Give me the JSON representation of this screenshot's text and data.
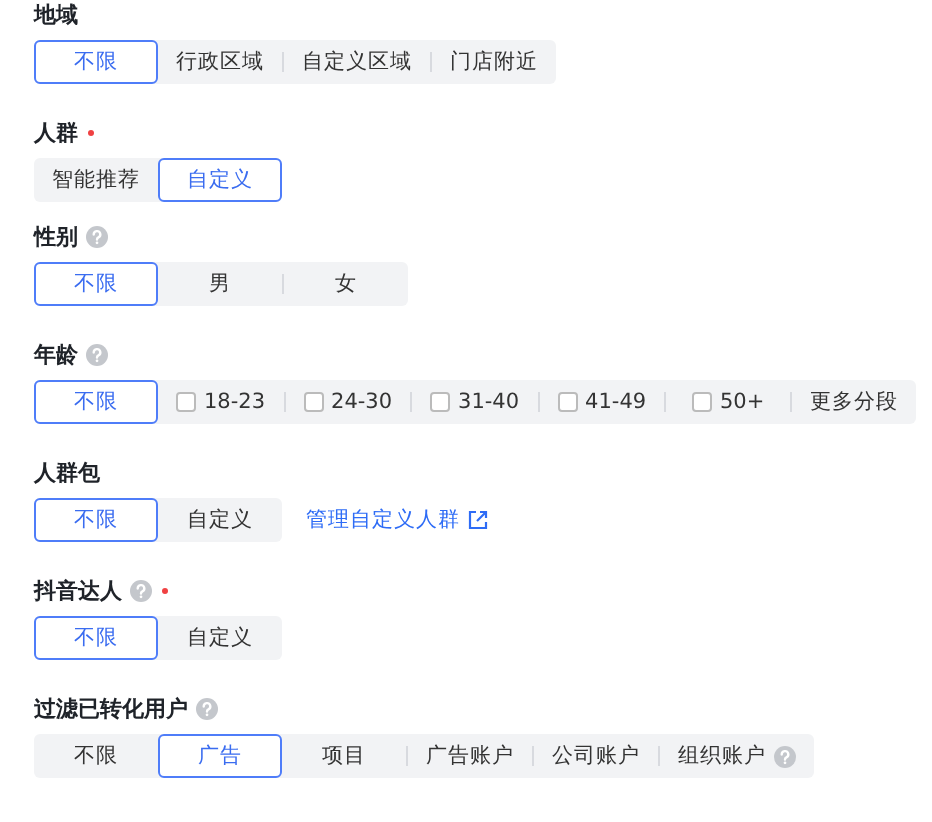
{
  "sections": [
    {
      "label": "地域",
      "required": false,
      "help": false,
      "options": [
        {
          "kind": "plain",
          "label": "不限",
          "selected": true
        },
        {
          "kind": "plain",
          "label": "行政区域",
          "selected": false
        },
        {
          "kind": "plain",
          "label": "自定义区域",
          "selected": false
        },
        {
          "kind": "plain",
          "label": "门店附近",
          "selected": false
        }
      ]
    },
    {
      "label": "人群",
      "required": true,
      "help": false,
      "options": [
        {
          "kind": "plain",
          "label": "智能推荐",
          "selected": false
        },
        {
          "kind": "plain",
          "label": "自定义",
          "selected": true
        }
      ]
    },
    {
      "label": "性别",
      "required": false,
      "help": true,
      "options": [
        {
          "kind": "plain",
          "label": "不限",
          "selected": true
        },
        {
          "kind": "plain",
          "label": "男",
          "selected": false
        },
        {
          "kind": "plain",
          "label": "女",
          "selected": false
        }
      ]
    },
    {
      "label": "年龄",
      "required": false,
      "help": true,
      "options": [
        {
          "kind": "plain",
          "label": "不限",
          "selected": true
        },
        {
          "kind": "checkbox",
          "label": "18-23",
          "selected": false,
          "checked": false
        },
        {
          "kind": "checkbox",
          "label": "24-30",
          "selected": false,
          "checked": false
        },
        {
          "kind": "checkbox",
          "label": "31-40",
          "selected": false,
          "checked": false
        },
        {
          "kind": "checkbox",
          "label": "41-49",
          "selected": false,
          "checked": false
        },
        {
          "kind": "checkbox",
          "label": "50+",
          "selected": false,
          "checked": false
        },
        {
          "kind": "plain",
          "label": "更多分段",
          "selected": false
        }
      ]
    },
    {
      "label": "人群包",
      "required": false,
      "help": false,
      "options": [
        {
          "kind": "plain",
          "label": "不限",
          "selected": true
        },
        {
          "kind": "plain",
          "label": "自定义",
          "selected": false
        }
      ],
      "link": "管理自定义人群"
    },
    {
      "label": "抖音达人",
      "required": true,
      "help": true,
      "options": [
        {
          "kind": "plain",
          "label": "不限",
          "selected": true
        },
        {
          "kind": "plain",
          "label": "自定义",
          "selected": false
        }
      ]
    },
    {
      "label": "过滤已转化用户",
      "required": false,
      "help": true,
      "options": [
        {
          "kind": "plain",
          "label": "不限",
          "selected": false
        },
        {
          "kind": "plain",
          "label": "广告",
          "selected": true
        },
        {
          "kind": "plain",
          "label": "项目",
          "selected": false
        },
        {
          "kind": "plain",
          "label": "广告账户",
          "selected": false
        },
        {
          "kind": "plain",
          "label": "公司账户",
          "selected": false
        },
        {
          "kind": "plain",
          "label": "组织账户",
          "selected": false,
          "help": true
        }
      ]
    }
  ]
}
